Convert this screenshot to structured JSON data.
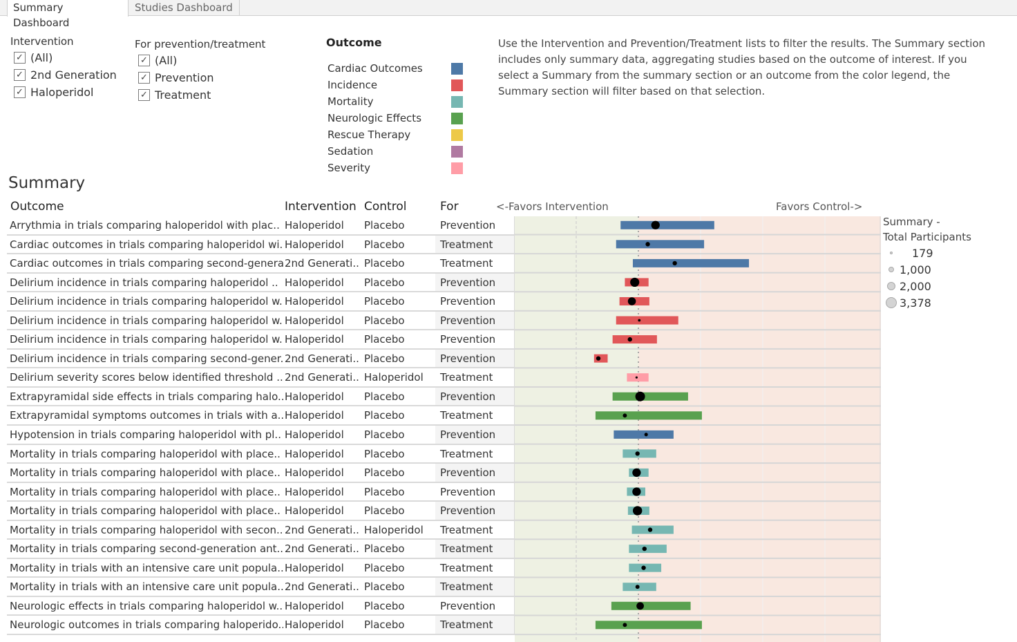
{
  "tabs": [
    {
      "label": "Summary Dashboard",
      "active": true
    },
    {
      "label": "Studies Dashboard",
      "active": false
    }
  ],
  "filters": {
    "intervention": {
      "title": "Intervention",
      "options": [
        {
          "label": "(All)",
          "checked": true
        },
        {
          "label": "2nd Generation",
          "checked": true
        },
        {
          "label": "Haloperidol",
          "checked": true
        }
      ]
    },
    "for": {
      "title": "For prevention/treatment",
      "options": [
        {
          "label": "(All)",
          "checked": true
        },
        {
          "label": "Prevention",
          "checked": true
        },
        {
          "label": "Treatment",
          "checked": true
        }
      ]
    }
  },
  "outcome_legend": {
    "title": "Outcome",
    "items": [
      {
        "label": "Cardiac Outcomes",
        "color": "#4e79a7"
      },
      {
        "label": "Incidence",
        "color": "#e15759"
      },
      {
        "label": "Mortality",
        "color": "#76b7b2"
      },
      {
        "label": "Neurologic Effects",
        "color": "#59a14f"
      },
      {
        "label": "Rescue Therapy",
        "color": "#edc948"
      },
      {
        "label": "Sedation",
        "color": "#b07aa1"
      },
      {
        "label": "Severity",
        "color": "#ff9da7"
      }
    ]
  },
  "info_text": "Use the Intervention and Prevention/Treatment lists to filter the results. The Summary section includes only summary data, aggregating studies based on the outcome of interest. If you select a Summary from the summary section or an outcome from the color legend, the Summary section will filter based on that selection.",
  "summary": {
    "title": "Summary",
    "columns": {
      "outcome": "Outcome",
      "intervention": "Intervention",
      "control": "Control",
      "for": "For"
    },
    "axis_left_label": "<-Favors Intervention",
    "axis_right_label": "Favors Control->"
  },
  "size_legend": {
    "title_line1": "Summary -",
    "title_line2": "Total Participants",
    "items": [
      {
        "label": "179",
        "value": 179
      },
      {
        "label": "1,000",
        "value": 1000
      },
      {
        "label": "2,000",
        "value": 2000
      },
      {
        "label": "3,378",
        "value": 3378
      }
    ]
  },
  "chart_data": {
    "type": "forest",
    "title": "Summary",
    "xlabel_left": "<-Favors Intervention",
    "xlabel_right": "Favors Control->",
    "x_scale": "log",
    "reference_value": 1,
    "xlim": [
      0.29,
      11.2
    ],
    "gridlines": [
      0.5,
      1,
      2,
      4,
      8
    ],
    "grid": true,
    "favors_intervention_bg": "#eef1e3",
    "favors_control_bg": "#f9e8e0",
    "point_color": "#000000",
    "rows": [
      {
        "outcome": "Arrythmia in trials comparing haloperidol with plac..",
        "intervention": "Haloperidol",
        "control": "Placebo",
        "for": "Prevention",
        "category": "Cardiac Outcomes",
        "estimate": 1.21,
        "ci_low": 0.82,
        "ci_high": 2.33,
        "participants": 2600
      },
      {
        "outcome": "Cardiac outcomes in trials comparing haloperidol wi..",
        "intervention": "Haloperidol",
        "control": "Placebo",
        "for": "Treatment",
        "category": "Cardiac Outcomes",
        "estimate": 1.11,
        "ci_low": 0.78,
        "ci_high": 2.08,
        "participants": 700
      },
      {
        "outcome": "Cardiac outcomes in trials comparing second-genera..",
        "intervention": "2nd Generati..",
        "control": "Placebo",
        "for": "Treatment",
        "category": "Cardiac Outcomes",
        "estimate": 1.5,
        "ci_low": 0.94,
        "ci_high": 3.43,
        "participants": 700
      },
      {
        "outcome": "Delirium incidence in trials comparing  haloperidol ..",
        "intervention": "Haloperidol",
        "control": "Placebo",
        "for": "Prevention",
        "category": "Incidence",
        "estimate": 0.96,
        "ci_low": 0.86,
        "ci_high": 1.12,
        "participants": 3000
      },
      {
        "outcome": "Delirium incidence in trials comparing haloperidol w..",
        "intervention": "Haloperidol",
        "control": "Placebo",
        "for": "Prevention",
        "category": "Incidence",
        "estimate": 0.93,
        "ci_low": 0.81,
        "ci_high": 1.13,
        "participants": 2300
      },
      {
        "outcome": "Delirium incidence in trials comparing haloperidol w..",
        "intervention": "Haloperidol",
        "control": "Placebo",
        "for": "Prevention",
        "category": "Incidence",
        "estimate": 1.01,
        "ci_low": 0.78,
        "ci_high": 1.56,
        "participants": 250
      },
      {
        "outcome": "Delirium incidence in trials comparing haloperidol w..",
        "intervention": "Haloperidol",
        "control": "Placebo",
        "for": "Prevention",
        "category": "Incidence",
        "estimate": 0.91,
        "ci_low": 0.75,
        "ci_high": 1.23,
        "participants": 700
      },
      {
        "outcome": "Delirium incidence in trials comparing second-gener..",
        "intervention": "2nd Generati..",
        "control": "Placebo",
        "for": "Prevention",
        "category": "Incidence",
        "estimate": 0.64,
        "ci_low": 0.61,
        "ci_high": 0.71,
        "participants": 700
      },
      {
        "outcome": "Delirium severity scores below identified threshold ..",
        "intervention": "2nd Generati..",
        "control": "Haloperidol",
        "for": "Treatment",
        "category": "Severity",
        "estimate": 0.98,
        "ci_low": 0.88,
        "ci_high": 1.12,
        "participants": 179
      },
      {
        "outcome": "Extrapyramidal side effects in trials comparing halo..",
        "intervention": "Haloperidol",
        "control": "Placebo",
        "for": "Prevention",
        "category": "Neurologic Effects",
        "estimate": 1.02,
        "ci_low": 0.75,
        "ci_high": 1.74,
        "participants": 3378
      },
      {
        "outcome": "Extrapyramidal symptoms outcomes in trials with a..",
        "intervention": "Haloperidol",
        "control": "Placebo",
        "for": "Treatment",
        "category": "Neurologic Effects",
        "estimate": 0.86,
        "ci_low": 0.62,
        "ci_high": 2.03,
        "participants": 600
      },
      {
        "outcome": "Hypotension in trials comparing haloperidol with pl..",
        "intervention": "Haloperidol",
        "control": "Placebo",
        "for": "Prevention",
        "category": "Cardiac Outcomes",
        "estimate": 1.09,
        "ci_low": 0.76,
        "ci_high": 1.48,
        "participants": 450
      },
      {
        "outcome": "Mortality in trials comparing haloperidol with place..",
        "intervention": "Haloperidol",
        "control": "Placebo",
        "for": "Treatment",
        "category": "Mortality",
        "estimate": 0.99,
        "ci_low": 0.84,
        "ci_high": 1.22,
        "participants": 700
      },
      {
        "outcome": "Mortality in trials comparing haloperidol with place..",
        "intervention": "Haloperidol",
        "control": "Placebo",
        "for": "Prevention",
        "category": "Mortality",
        "estimate": 0.98,
        "ci_low": 0.9,
        "ci_high": 1.12,
        "participants": 2600
      },
      {
        "outcome": "Mortality in trials comparing haloperidol with place..",
        "intervention": "Haloperidol",
        "control": "Placebo",
        "for": "Prevention",
        "category": "Mortality",
        "estimate": 0.98,
        "ci_low": 0.88,
        "ci_high": 1.08,
        "participants": 2600
      },
      {
        "outcome": "Mortality in trials comparing haloperidol with place..",
        "intervention": "Haloperidol",
        "control": "Placebo",
        "for": "Prevention",
        "category": "Mortality",
        "estimate": 0.99,
        "ci_low": 0.89,
        "ci_high": 1.13,
        "participants": 3100
      },
      {
        "outcome": "Mortality in trials comparing haloperidol with secon..",
        "intervention": "2nd Generati..",
        "control": "Haloperidol",
        "for": "Treatment",
        "category": "Mortality",
        "estimate": 1.14,
        "ci_low": 0.93,
        "ci_high": 1.48,
        "participants": 700
      },
      {
        "outcome": "Mortality in trials comparing second-generation ant..",
        "intervention": "2nd Generati..",
        "control": "Placebo",
        "for": "Treatment",
        "category": "Mortality",
        "estimate": 1.07,
        "ci_low": 0.9,
        "ci_high": 1.37,
        "participants": 700
      },
      {
        "outcome": "Mortality in trials with an intensive care unit popula..",
        "intervention": "Haloperidol",
        "control": "Placebo",
        "for": "Treatment",
        "category": "Mortality",
        "estimate": 1.06,
        "ci_low": 0.9,
        "ci_high": 1.29,
        "participants": 700
      },
      {
        "outcome": "Mortality in trials with an intensive care unit popula..",
        "intervention": "2nd Generati..",
        "control": "Placebo",
        "for": "Treatment",
        "category": "Mortality",
        "estimate": 0.99,
        "ci_low": 0.84,
        "ci_high": 1.22,
        "participants": 600
      },
      {
        "outcome": "Neurologic effects in trials comparing haloperidol w..",
        "intervention": "Haloperidol",
        "control": "Placebo",
        "for": "Prevention",
        "category": "Neurologic Effects",
        "estimate": 1.02,
        "ci_low": 0.74,
        "ci_high": 1.79,
        "participants": 2000
      },
      {
        "outcome": "Neurologic outcomes in trials comparing haloperido..",
        "intervention": "Haloperidol",
        "control": "Placebo",
        "for": "Treatment",
        "category": "Neurologic Effects",
        "estimate": 0.86,
        "ci_low": 0.62,
        "ci_high": 2.03,
        "participants": 600
      }
    ]
  }
}
